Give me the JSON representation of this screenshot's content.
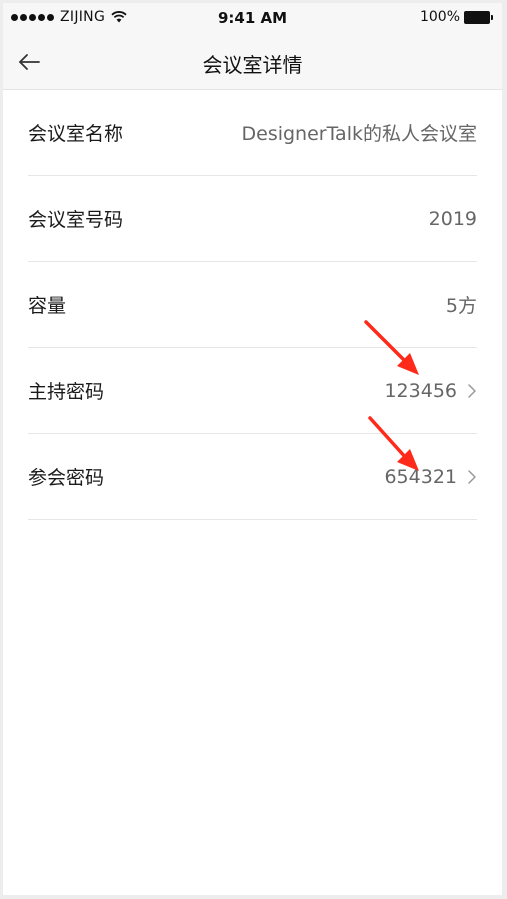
{
  "status_bar": {
    "carrier": "ZIJING",
    "time": "9:41 AM",
    "battery": "100%"
  },
  "nav": {
    "title": "会议室详情",
    "back_icon": "arrow-left-icon"
  },
  "rows": [
    {
      "label": "会议室名称",
      "value": "DesignerTalk的私人会议室",
      "has_chevron": false
    },
    {
      "label": "会议室号码",
      "value": "2019",
      "has_chevron": false
    },
    {
      "label": "容量",
      "value": "5方",
      "has_chevron": false
    },
    {
      "label": "主持密码",
      "value": "123456",
      "has_chevron": true
    },
    {
      "label": "参会密码",
      "value": "654321",
      "has_chevron": true
    }
  ],
  "colors": {
    "annotation_arrow": "#ff2a1a",
    "bar_background": "#f7f7f7",
    "value_text": "#666666"
  }
}
